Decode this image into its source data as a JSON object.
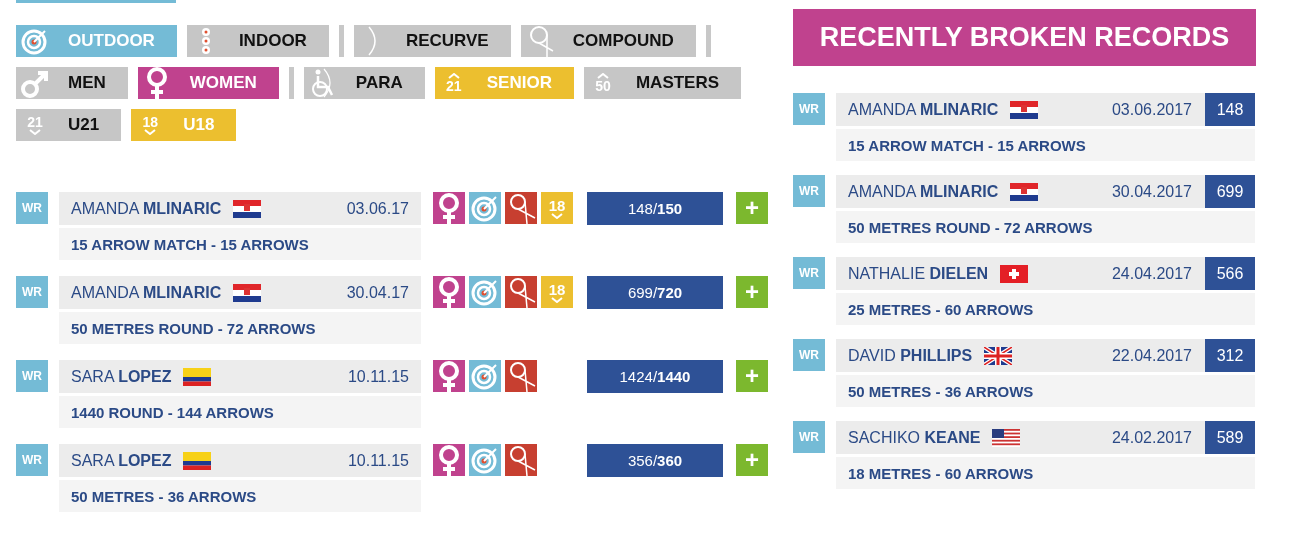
{
  "filter_rows": [
    {
      "items": [
        {
          "kind": "outdoor",
          "label": "OUTDOOR",
          "selected": true,
          "color": "#74bbd6"
        },
        {
          "kind": "indoor",
          "label": "INDOOR",
          "selected": false
        },
        {
          "kind": "separator"
        },
        {
          "kind": "recurve",
          "label": "RECURVE",
          "selected": false
        },
        {
          "kind": "compound",
          "label": "COMPOUND",
          "selected": false
        },
        {
          "kind": "separator"
        }
      ]
    },
    {
      "items": [
        {
          "kind": "men",
          "label": "MEN",
          "selected": false
        },
        {
          "kind": "women",
          "label": "WOMEN",
          "selected": true,
          "color": "#c0428e"
        },
        {
          "kind": "separator"
        },
        {
          "kind": "para",
          "label": "PARA",
          "selected": false
        },
        {
          "kind": "senior",
          "label": "SENIOR",
          "selected": true,
          "color": "#ecbf2f",
          "icon_text": "21"
        },
        {
          "kind": "masters",
          "label": "MASTERS",
          "selected": false,
          "icon_text": "50"
        }
      ]
    },
    {
      "items": [
        {
          "kind": "u21",
          "label": "U21",
          "selected": false,
          "icon_text": "21"
        },
        {
          "kind": "u18",
          "label": "U18",
          "selected": true,
          "color": "#ecbf2f",
          "icon_text": "18"
        }
      ]
    }
  ],
  "records": [
    {
      "badge": "WR",
      "first_name": "AMANDA",
      "last_name": "MLINARIC",
      "flag": {
        "kind": "croatia"
      },
      "date": "03.06.17",
      "event": "15 ARROW MATCH - 15 ARROWS",
      "categories": [
        {
          "kind": "women"
        },
        {
          "kind": "outdoor"
        },
        {
          "kind": "compound"
        },
        {
          "kind": "u18",
          "icon_text": "18"
        }
      ],
      "score": "148/**150**",
      "plus": "+"
    },
    {
      "badge": "WR",
      "first_name": "AMANDA",
      "last_name": "MLINARIC",
      "flag": {
        "kind": "croatia"
      },
      "date": "30.04.17",
      "event": "50 METRES ROUND - 72 ARROWS",
      "categories": [
        {
          "kind": "women"
        },
        {
          "kind": "outdoor"
        },
        {
          "kind": "compound"
        },
        {
          "kind": "u18",
          "icon_text": "18"
        }
      ],
      "score": "699/**720**",
      "plus": "+"
    },
    {
      "badge": "WR",
      "first_name": "SARA",
      "last_name": "LOPEZ",
      "flag": {
        "kind": "colombia"
      },
      "date": "10.11.15",
      "event": "1440 ROUND - 144 ARROWS",
      "categories": [
        {
          "kind": "women"
        },
        {
          "kind": "outdoor"
        },
        {
          "kind": "compound"
        }
      ],
      "score": "1424/**1440**",
      "plus": "+"
    },
    {
      "badge": "WR",
      "first_name": "SARA",
      "last_name": "LOPEZ",
      "flag": {
        "kind": "colombia"
      },
      "date": "10.11.15",
      "event": "50 METRES - 36 ARROWS",
      "categories": [
        {
          "kind": "women"
        },
        {
          "kind": "outdoor"
        },
        {
          "kind": "compound"
        }
      ],
      "score": "356/**360**",
      "plus": "+"
    }
  ],
  "recent": {
    "title": "RECENTLY BROKEN RECORDS",
    "items": [
      {
        "badge": "WR",
        "first_name": "AMANDA",
        "last_name": "MLINARIC",
        "flag": {
          "kind": "croatia"
        },
        "date": "03.06.2017",
        "score": "148",
        "event": "15 ARROW MATCH - 15 ARROWS"
      },
      {
        "badge": "WR",
        "first_name": "AMANDA",
        "last_name": "MLINARIC",
        "flag": {
          "kind": "croatia"
        },
        "date": "30.04.2017",
        "score": "699",
        "event": "50 METRES ROUND - 72 ARROWS"
      },
      {
        "badge": "WR",
        "first_name": "NATHALIE",
        "last_name": "DIELEN",
        "flag": {
          "kind": "switzerland"
        },
        "date": "24.04.2017",
        "score": "566",
        "event": "25 METRES - 60 ARROWS"
      },
      {
        "badge": "WR",
        "first_name": "DAVID",
        "last_name": "PHILLIPS",
        "flag": {
          "kind": "uk"
        },
        "date": "22.04.2017",
        "score": "312",
        "event": "50 METRES - 36 ARROWS"
      },
      {
        "badge": "WR",
        "first_name": "SACHIKO",
        "last_name": "KEANE",
        "flag": {
          "kind": "usa"
        },
        "date": "24.02.2017",
        "score": "589",
        "event": "18 METRES - 60 ARROWS"
      }
    ]
  }
}
